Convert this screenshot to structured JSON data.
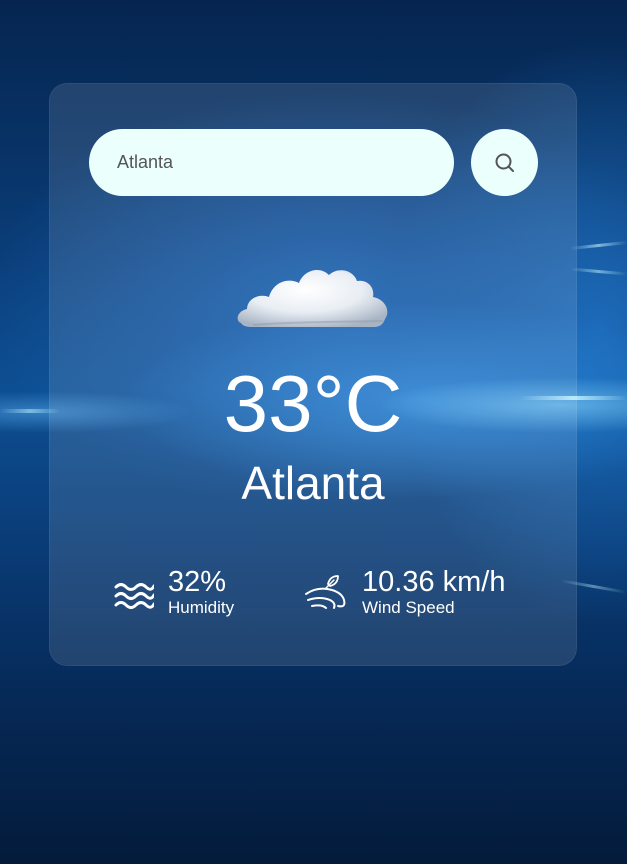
{
  "search": {
    "value": "Atlanta",
    "icon": "search-icon"
  },
  "weather": {
    "icon": "cloud-icon",
    "temperature": "33°C",
    "city": "Atlanta"
  },
  "details": {
    "humidity": {
      "icon": "humidity-waves-icon",
      "value": "32%",
      "label": "Humidity"
    },
    "wind": {
      "icon": "wind-icon",
      "value": "10.36 km/h",
      "label": "Wind Speed"
    }
  },
  "colors": {
    "input_background": "#ebfffc",
    "text": "#ffffff"
  }
}
